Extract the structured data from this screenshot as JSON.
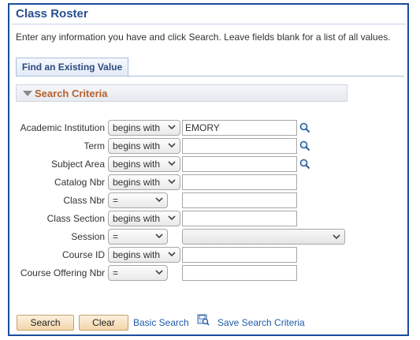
{
  "page": {
    "title": "Class Roster",
    "instructions": "Enter any information you have and click Search. Leave fields blank for a list of all values."
  },
  "tabs": [
    {
      "label": "Find an Existing Value",
      "active": true
    }
  ],
  "section": {
    "title": "Search Criteria",
    "expanded": true
  },
  "fields": [
    {
      "label": "Academic Institution",
      "operator": "begins with",
      "value": "EMORY",
      "lookup": true
    },
    {
      "label": "Term",
      "operator": "begins with",
      "value": "",
      "lookup": true
    },
    {
      "label": "Subject Area",
      "operator": "begins with",
      "value": "",
      "lookup": true
    },
    {
      "label": "Catalog Nbr",
      "operator": "begins with",
      "value": "",
      "lookup": false
    },
    {
      "label": "Class Nbr",
      "operator": "=",
      "value": "",
      "lookup": false
    },
    {
      "label": "Class Section",
      "operator": "begins with",
      "value": "",
      "lookup": false
    },
    {
      "label": "Session",
      "operator": "=",
      "value": "",
      "lookup": false,
      "value_is_dropdown": true
    },
    {
      "label": "Course ID",
      "operator": "begins with",
      "value": "",
      "lookup": false
    },
    {
      "label": "Course Offering Nbr",
      "operator": "=",
      "value": "",
      "lookup": false
    }
  ],
  "actions": {
    "search_label": "Search",
    "clear_label": "Clear",
    "basic_search_label": "Basic Search",
    "save_criteria_label": "Save Search Criteria"
  },
  "colors": {
    "frame_border": "#1a4d9c",
    "title": "#2a4f8f",
    "section_title": "#b5602c",
    "link": "#1d5aa8",
    "button_fill": "#f3d5a8"
  },
  "icons": {
    "lookup": "magnifier-icon",
    "save_criteria": "save-search-icon",
    "section_toggle": "collapse-triangle-icon"
  }
}
